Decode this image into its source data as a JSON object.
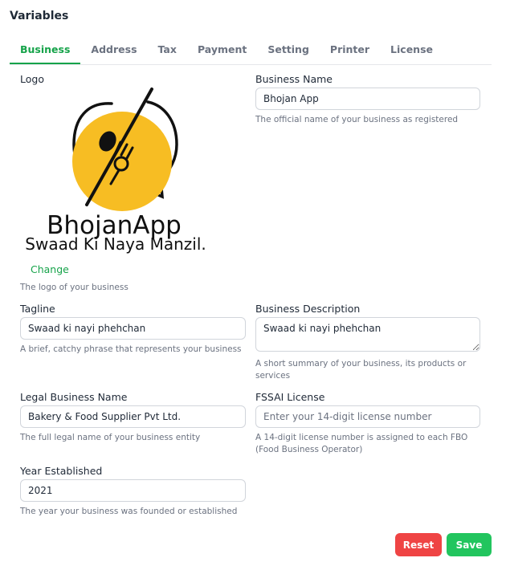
{
  "page": {
    "title": "Variables"
  },
  "tabs": [
    {
      "label": "Business",
      "active": true
    },
    {
      "label": "Address"
    },
    {
      "label": "Tax"
    },
    {
      "label": "Payment"
    },
    {
      "label": "Setting"
    },
    {
      "label": "Printer"
    },
    {
      "label": "License"
    }
  ],
  "logo": {
    "label": "Logo",
    "brand_text": "BhojanApp",
    "tagline_text": "Swaad Ki Naya Manzil.",
    "change_label": "Change",
    "help": "The logo of your business",
    "colors": {
      "circle": "#f7bd23",
      "ink": "#111111"
    }
  },
  "business_name": {
    "label": "Business Name",
    "value": "Bhojan App",
    "help": "The official name of your business as registered"
  },
  "tagline": {
    "label": "Tagline",
    "value": "Swaad ki nayi phehchan",
    "help": "A brief, catchy phrase that represents your business"
  },
  "business_description": {
    "label": "Business Description",
    "value": "Swaad ki nayi phehchan",
    "help": "A short summary of your business, its products or services"
  },
  "legal_name": {
    "label": "Legal Business Name",
    "value": "Bakery & Food Supplier Pvt Ltd.",
    "help": "The full legal name of your business entity"
  },
  "fssai": {
    "label": "FSSAI License",
    "value": "",
    "placeholder": "Enter your 14-digit license number",
    "help": "A 14-digit license number is assigned to each FBO (Food Business Operator)"
  },
  "year_established": {
    "label": "Year Established",
    "value": "2021",
    "help": "The year your business was founded or established"
  },
  "actions": {
    "reset_label": "Reset",
    "save_label": "Save"
  },
  "colors": {
    "accent": "#16a34a",
    "reset": "#ef4444",
    "save": "#22c55e"
  }
}
